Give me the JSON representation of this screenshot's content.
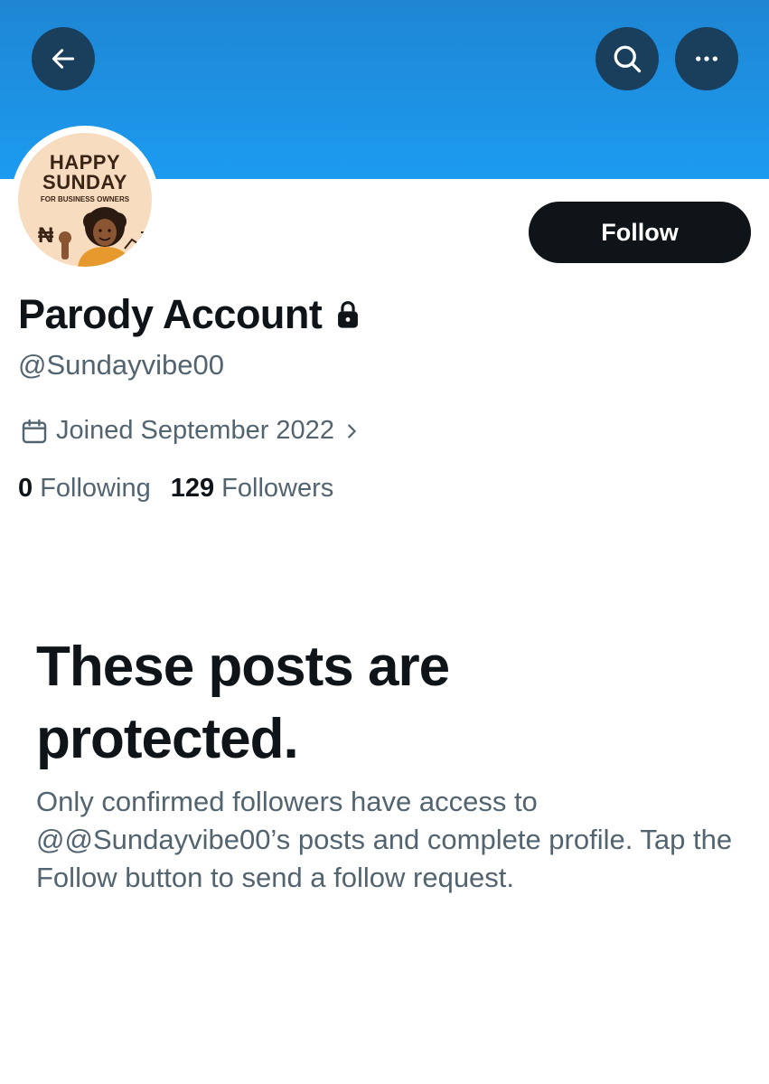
{
  "header": {
    "back_icon": "arrow-left-icon",
    "search_icon": "search-icon",
    "more_icon": "more-horizontal-icon",
    "banner_color": "#1d9bf0"
  },
  "avatar": {
    "line1": "HAPPY",
    "line2": "SUNDAY",
    "line3": "FOR BUSINESS OWNERS",
    "symbol": "₦"
  },
  "profile": {
    "follow_label": "Follow",
    "display_name": "Parody Account",
    "lock_icon": "lock-icon",
    "handle": "@Sundayvibe00",
    "joined": "Joined September 2022",
    "following_count": "0",
    "following_label": "Following",
    "followers_count": "129",
    "followers_label": "Followers"
  },
  "protected": {
    "title": "These posts are protected.",
    "body": "Only confirmed followers have access to @@Sundayvibe00’s posts and complete profile. Tap the Follow button to send a follow request."
  }
}
